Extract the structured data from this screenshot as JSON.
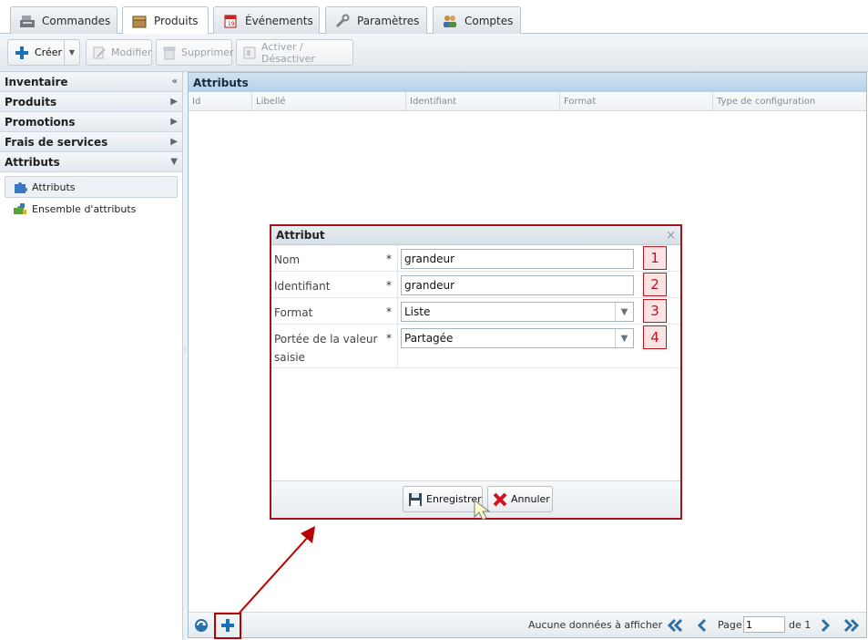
{
  "tabs": [
    {
      "label": "Commandes"
    },
    {
      "label": "Produits"
    },
    {
      "label": "Événements"
    },
    {
      "label": "Paramètres"
    },
    {
      "label": "Comptes"
    }
  ],
  "toolbar": {
    "create": "Créer",
    "modify": "Modifier",
    "delete": "Supprimer",
    "toggle": "Activer / Désactiver"
  },
  "sidebar": {
    "sections": [
      {
        "label": "Inventaire",
        "arrow": "«"
      },
      {
        "label": "Produits",
        "arrow": "▶"
      },
      {
        "label": "Promotions",
        "arrow": "▶"
      },
      {
        "label": "Frais de services",
        "arrow": "▶"
      },
      {
        "label": "Attributs",
        "arrow": "▼"
      }
    ],
    "items": [
      {
        "label": "Attributs"
      },
      {
        "label": "Ensemble d'attributs"
      }
    ]
  },
  "grid": {
    "title": "Attributs",
    "columns": [
      "Id",
      "Libellé",
      "Identifiant",
      "Format",
      "Type de configuration"
    ]
  },
  "pager": {
    "empty": "Aucune données à afficher",
    "page_label": "Page",
    "page_value": "1",
    "of_label": "de 1"
  },
  "dialog": {
    "title": "Attribut",
    "close": "×",
    "fields": [
      {
        "label": "Nom",
        "required": "*",
        "value": "grandeur",
        "badge": "1"
      },
      {
        "label": "Identifiant",
        "required": "*",
        "value": "grandeur",
        "badge": "2"
      },
      {
        "label": "Format",
        "required": "*",
        "value": "Liste",
        "badge": "3"
      },
      {
        "label": "Portée de la valeur saisie",
        "required": "*",
        "value": "Partagée",
        "badge": "4"
      }
    ],
    "save": "Enregistrer",
    "cancel": "Annuler"
  },
  "colors": {
    "annotation_red": "#b80000",
    "panel_blue": "#b5d2ea"
  }
}
